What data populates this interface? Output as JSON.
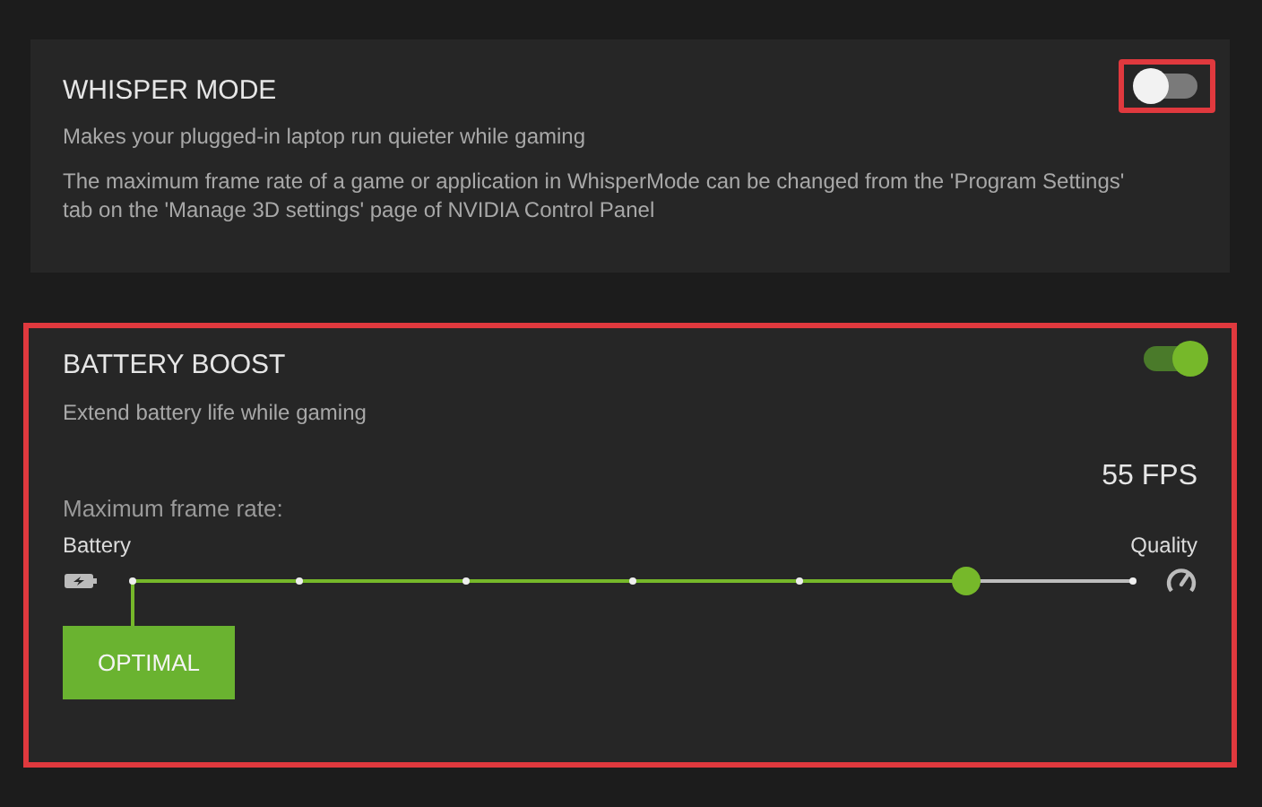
{
  "whisper_mode": {
    "title": "WHISPER MODE",
    "on": false,
    "toggle_highlighted": true,
    "description": "Makes your plugged-in laptop run quieter while gaming",
    "note": "The maximum frame rate of a game or application in WhisperMode can be changed from the 'Program Settings' tab on the 'Manage 3D settings' page of NVIDIA Control Panel"
  },
  "battery_boost": {
    "title": "BATTERY BOOST",
    "on": true,
    "highlighted": true,
    "description": "Extend battery life while gaming",
    "frame_rate_label": "Maximum frame rate:",
    "frame_rate_value": "55 FPS",
    "slider": {
      "min_label": "Battery",
      "max_label": "Quality",
      "level": 0.833
    },
    "button": "OPTIMAL"
  }
}
